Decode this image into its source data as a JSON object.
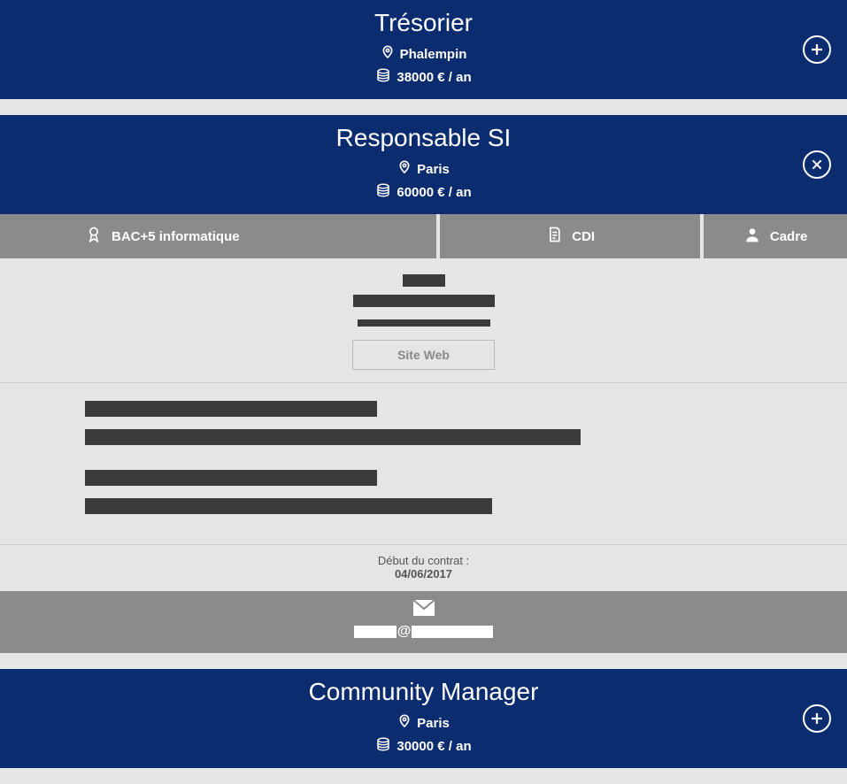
{
  "jobs": [
    {
      "title": "Trésorier",
      "location": "Phalempin",
      "salary": "38000 € / an",
      "action": "expand"
    },
    {
      "title": "Responsable SI",
      "location": "Paris",
      "salary": "60000 € / an",
      "action": "close",
      "meta": {
        "education": "BAC+5 informatique",
        "contract_type": "CDI",
        "status": "Cadre"
      },
      "site_button": "Site Web",
      "contract": {
        "label": "Début du contrat :",
        "date": "04/06/2017"
      },
      "email_at": "@"
    },
    {
      "title": "Community Manager",
      "location": "Paris",
      "salary": "30000 € / an",
      "action": "expand"
    }
  ]
}
